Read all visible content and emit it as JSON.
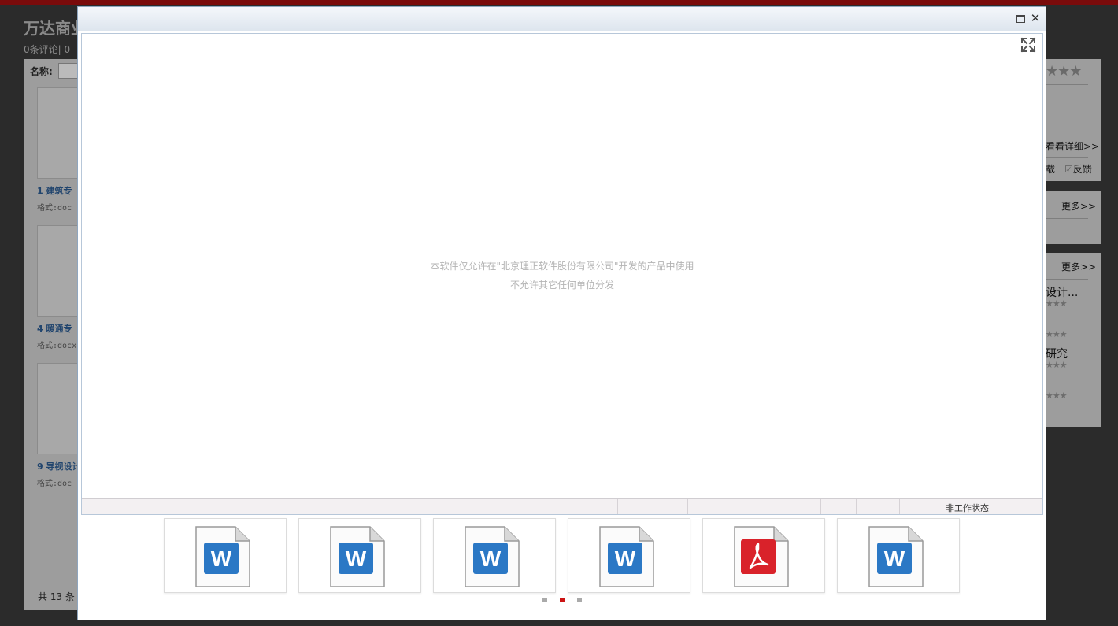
{
  "background": {
    "title": "万达商业",
    "subtitle": "0条评论|  0",
    "name_label": "名称:",
    "items": [
      {
        "label": "1  建筑专",
        "format": "格式:doc"
      },
      {
        "label": "4  暖通专",
        "format": "格式:docx"
      },
      {
        "label": "9  导视设计",
        "format": "格式:doc"
      }
    ],
    "total": "共 13 条",
    "right": {
      "rating_stars": "★★★",
      "view_detail": "看看详细>>",
      "download": "载",
      "feedback": "反馈",
      "more_1": "更多>>",
      "more_2": "更多>>",
      "list": [
        {
          "title": "设计...",
          "stars": "★★★"
        },
        {
          "title": "",
          "stars": "★★★"
        },
        {
          "title": "研究",
          "stars": "★★★"
        },
        {
          "title": "",
          "stars": "★★★"
        }
      ]
    }
  },
  "viewer": {
    "notice_line1": "本软件仅允许在\"北京理正软件股份有限公司\"开发的产品中使用",
    "notice_line2": "不允许其它任何单位分发",
    "status_text": "非工作状态"
  },
  "thumbnails": [
    {
      "type": "word",
      "icon": "word-file-icon"
    },
    {
      "type": "word",
      "icon": "word-file-icon"
    },
    {
      "type": "word",
      "icon": "word-file-icon"
    },
    {
      "type": "word",
      "icon": "word-file-icon"
    },
    {
      "type": "pdf",
      "icon": "pdf-file-icon"
    },
    {
      "type": "word",
      "icon": "word-file-icon"
    }
  ],
  "pager": {
    "pages": 3,
    "current": 2
  },
  "colors": {
    "accent_red": "#cc1414",
    "word_blue": "#2b78c5",
    "pdf_red": "#d9222a"
  }
}
